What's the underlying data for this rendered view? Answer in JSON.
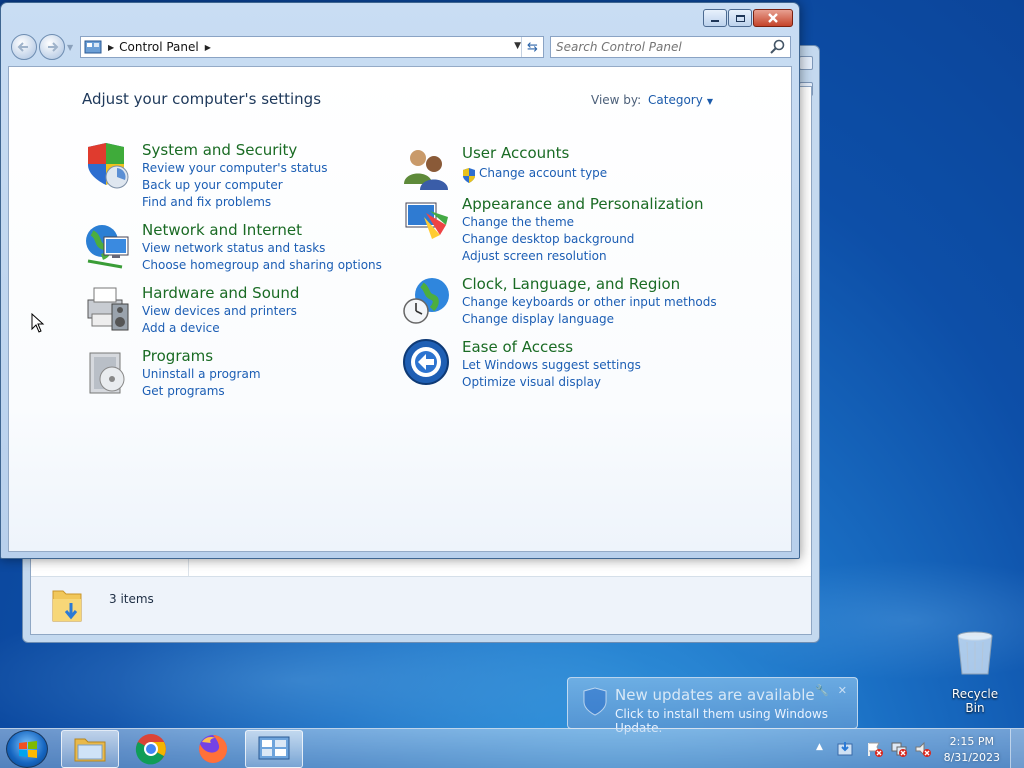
{
  "window": {
    "breadcrumb": "Control Panel",
    "search_placeholder": "Search Control Panel"
  },
  "main": {
    "heading": "Adjust your computer's settings",
    "view_by_label": "View by:",
    "view_by_value": "Category",
    "left_categories": [
      {
        "title": "System and Security",
        "links": [
          "Review your computer's status",
          "Back up your computer",
          "Find and fix problems"
        ]
      },
      {
        "title": "Network and Internet",
        "links": [
          "View network status and tasks",
          "Choose homegroup and sharing options"
        ]
      },
      {
        "title": "Hardware and Sound",
        "links": [
          "View devices and printers",
          "Add a device"
        ]
      },
      {
        "title": "Programs",
        "links": [
          "Uninstall a program",
          "Get programs"
        ]
      }
    ],
    "right_categories": [
      {
        "title": "User Accounts",
        "links": [
          "Change account type"
        ]
      },
      {
        "title": "Appearance and Personalization",
        "links": [
          "Change the theme",
          "Change desktop background",
          "Adjust screen resolution"
        ]
      },
      {
        "title": "Clock, Language, and Region",
        "links": [
          "Change keyboards or other input methods",
          "Change display language"
        ]
      },
      {
        "title": "Ease of Access",
        "links": [
          "Let Windows suggest settings",
          "Optimize visual display"
        ]
      }
    ]
  },
  "background_window": {
    "status_text": "3 items"
  },
  "notification": {
    "title": "New updates are available",
    "subtitle": "Click to install them using Windows Update."
  },
  "desktop": {
    "recycle_bin_label": "Recycle Bin"
  },
  "taskbar": {
    "time": "2:15 PM",
    "date": "8/31/2023",
    "apps": [
      "windows-explorer",
      "google-chrome",
      "firefox",
      "control-panel"
    ]
  }
}
